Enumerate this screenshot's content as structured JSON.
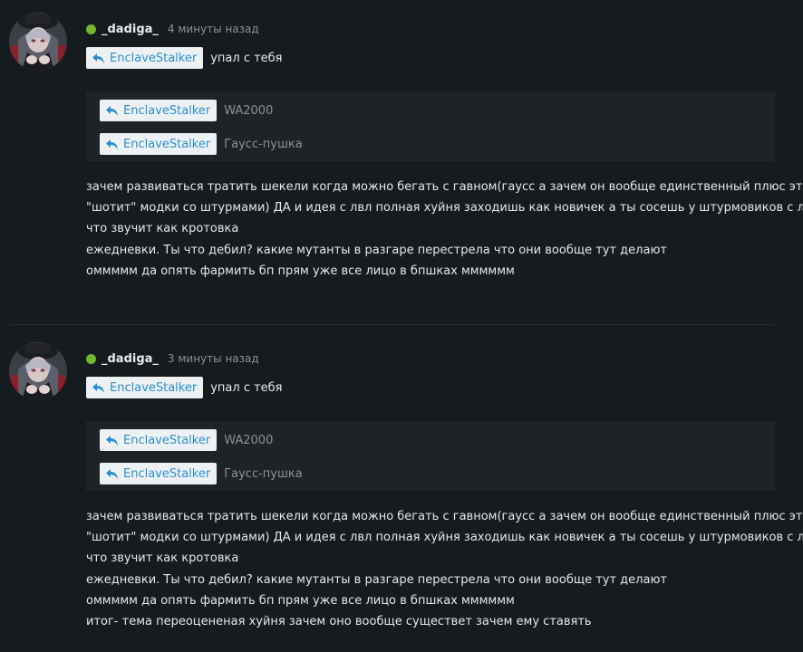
{
  "posts": [
    {
      "username": "_dadiga_",
      "time": "4 минуты назад",
      "reply": {
        "user": "EnclaveStalker",
        "text": "упал с тебя"
      },
      "quotes": [
        {
          "user": "EnclaveStalker",
          "text": "WA2000"
        },
        {
          "user": "EnclaveStalker",
          "text": "Гаусс-пушка"
        }
      ],
      "lines": [
        "зачем развиваться тратить шекели когда можно бегать с гавном(гаусс а зачем он вообще единственный плюс это",
        "\"шотит\" модки со штурмами) ДА и идея с лвл полная хуйня заходишь как новичек а ты сосешь у штурмовиков с лр а",
        "что звучит как кротовка",
        "ежедневки. Ты что дебил? какие мутанты в разгаре перестрела что они вообще тут делают",
        "оммммм да опять фармить бп прям уже все лицо в бпшках мммммм"
      ]
    },
    {
      "username": "_dadiga_",
      "time": "3 минуты назад",
      "reply": {
        "user": "EnclaveStalker",
        "text": "упал с тебя"
      },
      "quotes": [
        {
          "user": "EnclaveStalker",
          "text": "WA2000"
        },
        {
          "user": "EnclaveStalker",
          "text": "Гаусс-пушка"
        }
      ],
      "lines": [
        "зачем развиваться тратить шекели когда можно бегать с гавном(гаусс а зачем он вообще единственный плюс это",
        "\"шотит\" модки со штурмами) ДА и идея с лвл полная хуйня заходишь как новичек а ты сосешь у штурмовиков с лр а",
        "что звучит как кротовка",
        "ежедневки. Ты что дебил? какие мутанты в разгаре перестрела что они вообще тут делают",
        "оммммм да опять фармить бп прям уже все лицо в бпшках мммммм",
        "итог- тема переоцененая хуйня зачем оно вообще существет зачем ему ставять"
      ]
    }
  ],
  "colors": {
    "background": "#161b1f",
    "quote_background": "#1e2327",
    "online": "#74b72e",
    "chip_text": "#2a8fd0",
    "muted": "#8a9299"
  },
  "icons": {
    "reply": "reply-arrow-icon",
    "status": "online-status-icon"
  }
}
